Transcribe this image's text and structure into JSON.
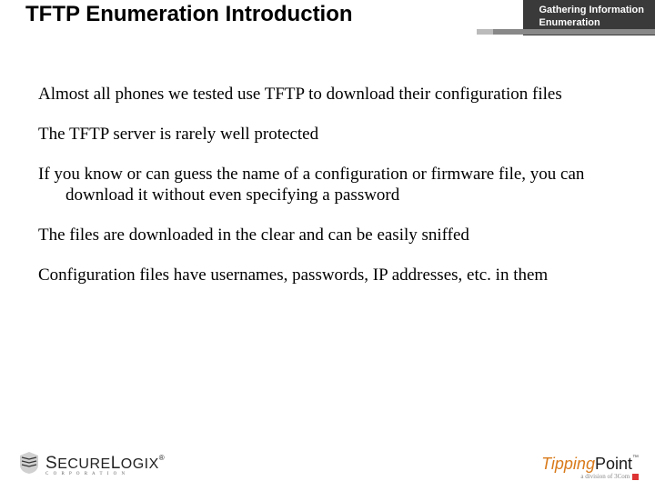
{
  "header": {
    "line1": "Gathering Information",
    "line2": "Enumeration"
  },
  "title": "TFTP Enumeration Introduction",
  "bullets": [
    "Almost all phones we tested use TFTP to download their configuration files",
    "The TFTP server is rarely well protected",
    "If you know or can guess the name of a configuration or firmware file, you can download it without even specifying a password",
    "The files are downloaded in the clear and can be easily sniffed",
    "Configuration files have usernames, passwords, IP addresses, etc. in them"
  ],
  "logo_left": {
    "name_part1": "S",
    "name_part2": "ECURE",
    "name_part3": "L",
    "name_part4": "OGIX",
    "reg": "®",
    "sub": "C O R P O R A T I O N"
  },
  "logo_right": {
    "part1": "Tipping",
    "part2": "Point",
    "tm": "™",
    "sub": "a division of 3Com"
  }
}
